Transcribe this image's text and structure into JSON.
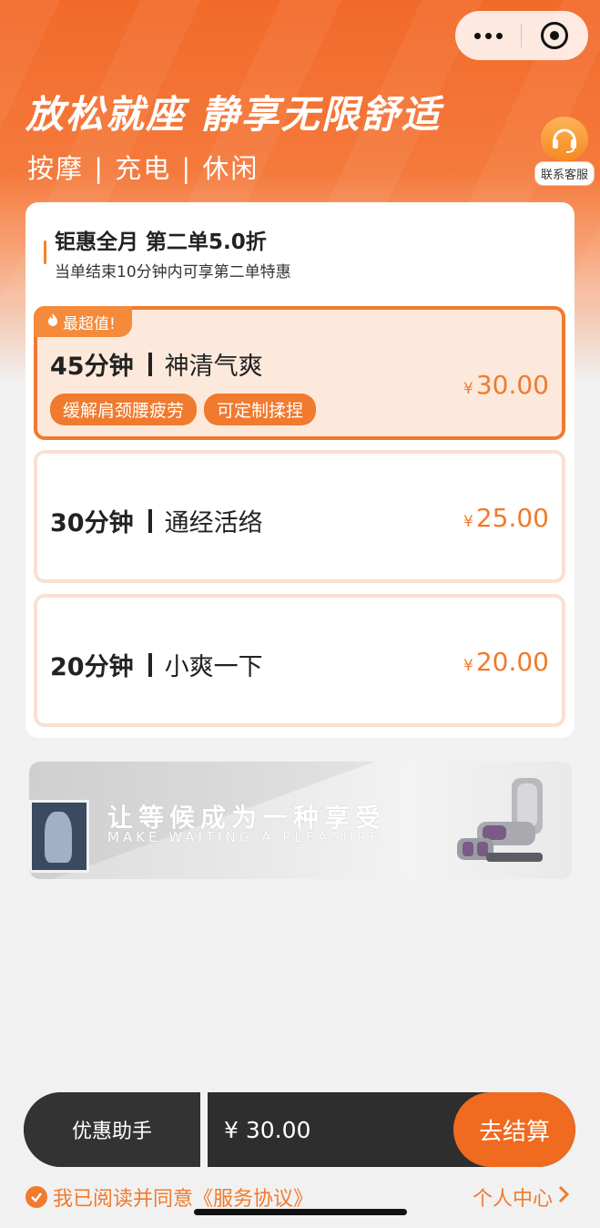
{
  "header": {
    "title": "放松就座 静享无限舒适",
    "subtitle": "按摩 | 充电 | 休闲",
    "customer_service": "联系客服"
  },
  "promo": {
    "title": "钜惠全月 第二单5.0折",
    "desc": "当单结束10分钟内可享第二单特惠"
  },
  "options": [
    {
      "badge": "最超值!",
      "duration": "45分钟",
      "name": "神清气爽",
      "tags": [
        "缓解肩颈腰疲劳",
        "可定制揉捏"
      ],
      "currency": "¥",
      "price": "30.00",
      "selected": true
    },
    {
      "duration": "30分钟",
      "name": "通经活络",
      "currency": "¥",
      "price": "25.00",
      "selected": false
    },
    {
      "duration": "20分钟",
      "name": "小爽一下",
      "currency": "¥",
      "price": "20.00",
      "selected": false
    }
  ],
  "banner": {
    "cn": "让等候成为一种享受",
    "en": "MAKE WAITING A PLEASURE"
  },
  "footer": {
    "helper": "优惠助手",
    "total": "¥ 30.00",
    "checkout": "去结算",
    "agree_text": "我已阅读并同意",
    "agreement_link": "《服务协议》",
    "personal_center": "个人中心"
  },
  "colors": {
    "accent": "#f07a2e",
    "dark_bar": "#2e2e2e"
  },
  "icons": [
    "more-dots-icon",
    "close-circle-icon",
    "headset-icon",
    "fire-icon",
    "check-circle-icon",
    "chevron-right-icon"
  ]
}
